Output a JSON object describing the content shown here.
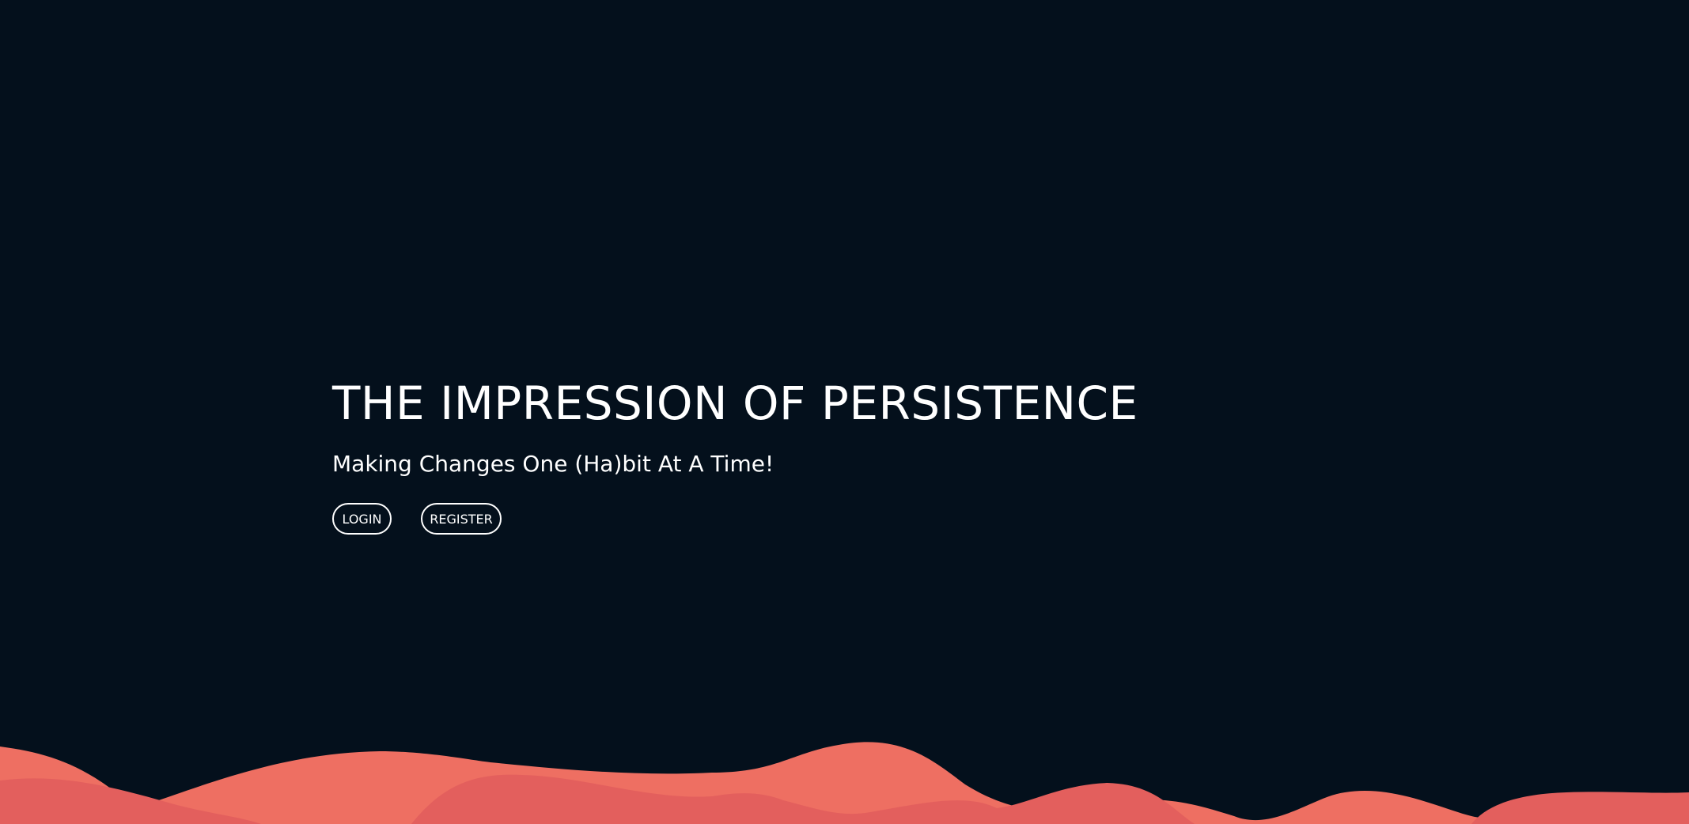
{
  "hero": {
    "title": "THE IMPRESSION OF PERSISTENCE",
    "subtitle": "Making Changes One (Ha)bit At A Time!"
  },
  "actions": {
    "login_label": "LOGIN",
    "register_label": "REGISTER"
  },
  "colors": {
    "background": "#04101c",
    "text": "#ffffff",
    "wave_light": "#ee6f62",
    "wave_dark": "#e35f5d"
  }
}
